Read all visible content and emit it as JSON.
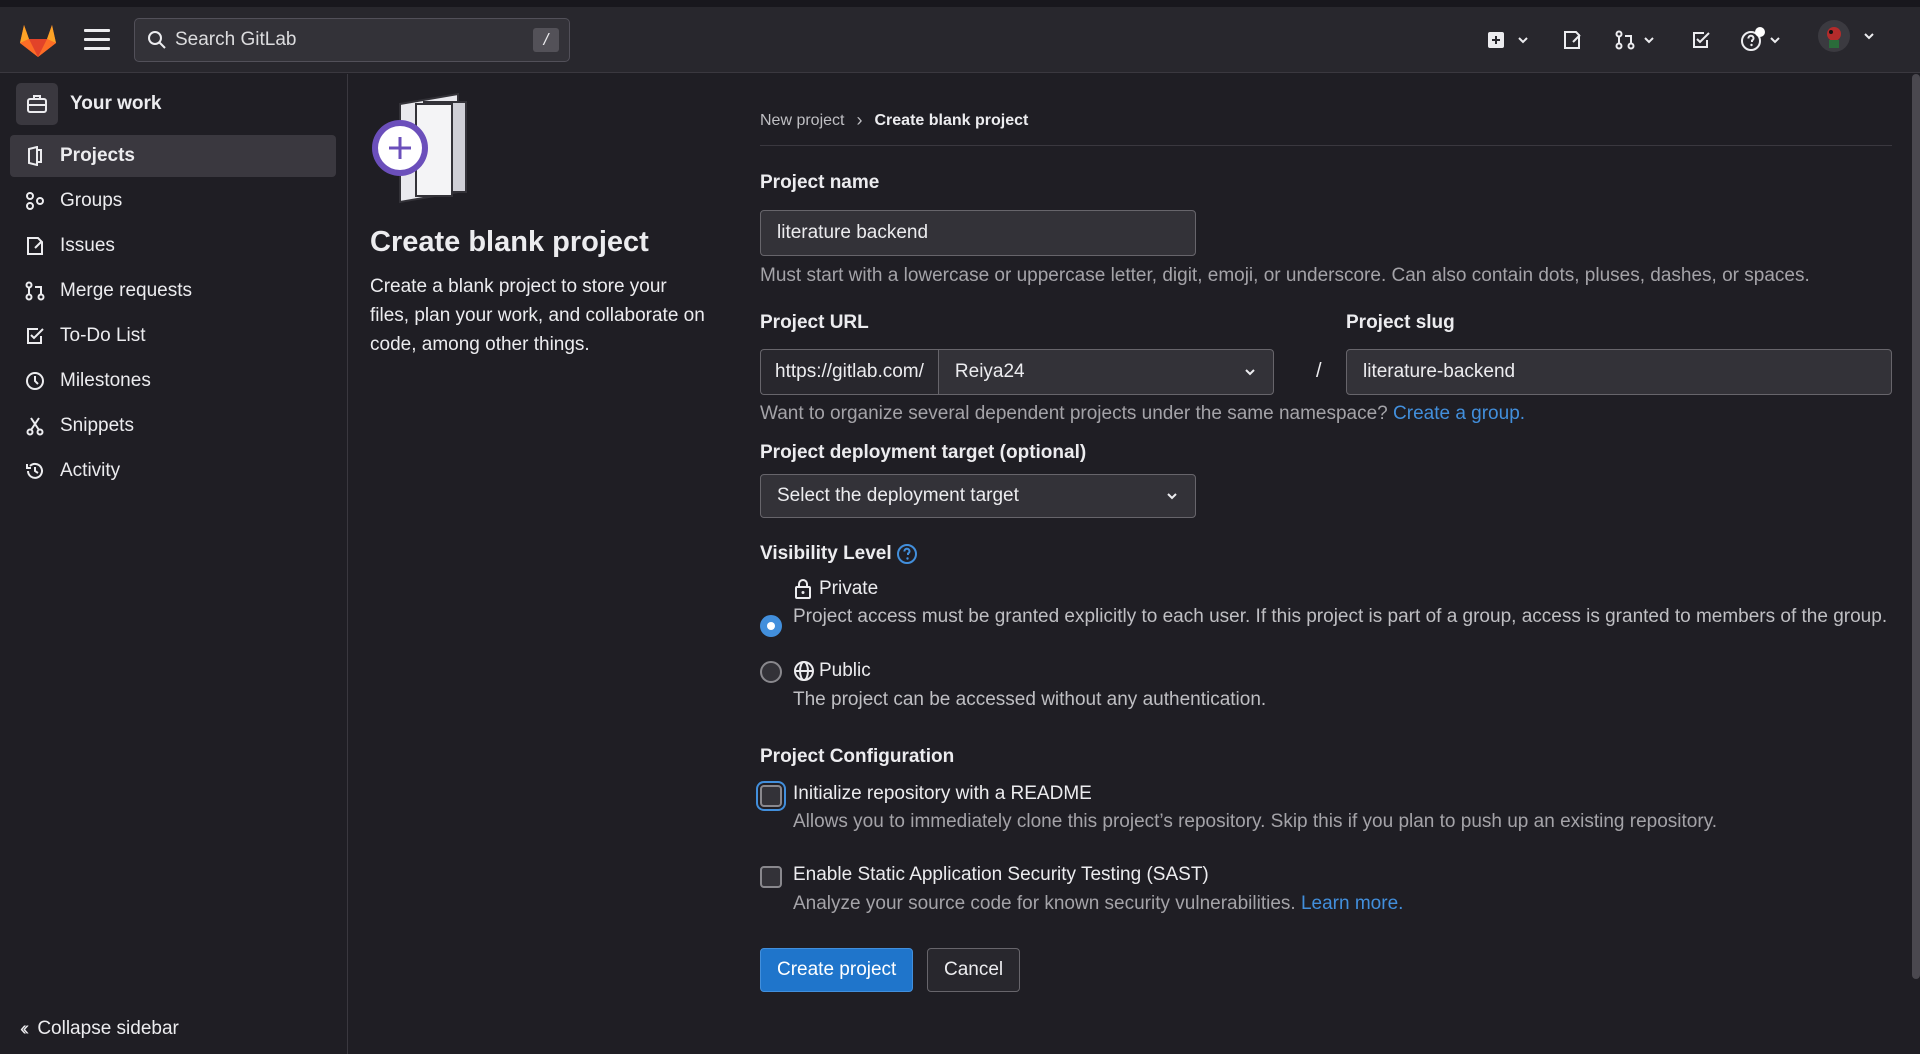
{
  "header": {
    "search_placeholder": "Search GitLab",
    "search_shortcut": "/"
  },
  "sidebar": {
    "context_label": "Your work",
    "items": [
      {
        "label": "Projects",
        "icon": "project-icon",
        "active": true
      },
      {
        "label": "Groups",
        "icon": "group-icon"
      },
      {
        "label": "Issues",
        "icon": "issues-icon"
      },
      {
        "label": "Merge requests",
        "icon": "merge-request-icon"
      },
      {
        "label": "To-Do List",
        "icon": "todo-icon"
      },
      {
        "label": "Milestones",
        "icon": "clock-icon"
      },
      {
        "label": "Snippets",
        "icon": "snippet-icon"
      },
      {
        "label": "Activity",
        "icon": "history-icon"
      }
    ],
    "collapse_label": "Collapse sidebar"
  },
  "intro": {
    "title": "Create blank project",
    "description": "Create a blank project to store your files, plan your work, and collaborate on code, among other things."
  },
  "breadcrumb": {
    "parent": "New project",
    "current": "Create blank project"
  },
  "form": {
    "project_name_label": "Project name",
    "project_name_value": "literature backend",
    "project_name_help": "Must start with a lowercase or uppercase letter, digit, emoji, or underscore. Can also contain dots, pluses, dashes, or spaces.",
    "project_url_label": "Project URL",
    "url_prefix": "https://gitlab.com/",
    "namespace": "Reiya24",
    "slash": "/",
    "project_slug_label": "Project slug",
    "project_slug_value": "literature-backend",
    "namespace_help": "Want to organize several dependent projects under the same namespace?",
    "create_group_link": "Create a group.",
    "deployment_label": "Project deployment target (optional)",
    "deployment_placeholder": "Select the deployment target",
    "visibility_label": "Visibility Level",
    "visibility_options": [
      {
        "label": "Private",
        "description": "Project access must be granted explicitly to each user. If this project is part of a group, access is granted to members of the group.",
        "checked": true
      },
      {
        "label": "Public",
        "description": "The project can be accessed without any authentication.",
        "checked": false
      }
    ],
    "config_label": "Project Configuration",
    "readme_label": "Initialize repository with a README",
    "readme_help": "Allows you to immediately clone this project’s repository. Skip this if you plan to push up an existing repository.",
    "sast_label": "Enable Static Application Security Testing (SAST)",
    "sast_help": "Analyze your source code for known security vulnerabilities.",
    "learn_more_link": "Learn more.",
    "create_button": "Create project",
    "cancel_button": "Cancel"
  },
  "colors": {
    "accent": "#428fdc",
    "primary_button": "#1f75cb",
    "brand_orange": "#fc6d26"
  }
}
